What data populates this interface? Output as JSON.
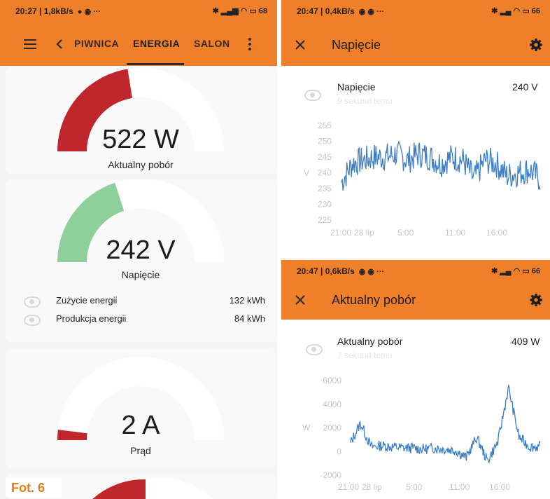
{
  "left": {
    "status": {
      "time": "20:27 | 1,8kB/s",
      "battery": "68"
    },
    "tabs": [
      "PIWNICA",
      "ENERGIA",
      "SALON"
    ],
    "gauges": [
      {
        "value": "522 W",
        "label": "Aktualny pobór",
        "level": 0.45,
        "color": "#c0272d"
      },
      {
        "value": "242 V",
        "label": "Napięcie",
        "level": 0.4,
        "color": "#8fcf9c"
      },
      {
        "value": "2 A",
        "label": "Prąd",
        "level": 0.04,
        "color": "#c0272d"
      }
    ],
    "list": [
      {
        "label": "Zużycie energii",
        "value": "132 kWh"
      },
      {
        "label": "Produkcja energii",
        "value": "84 kWh"
      }
    ]
  },
  "right_top": {
    "status": {
      "time": "20:47 | 0,4kB/s",
      "battery": "66"
    },
    "title": "Napięcie",
    "chart_title": "Napięcie",
    "chart_sub": "9 sekund temu",
    "chart_value": "240 V",
    "ylabel": "V"
  },
  "right_bottom": {
    "status": {
      "time": "20:47 | 0,6kB/s",
      "battery": "66"
    },
    "title": "Aktualny pobór",
    "chart_title": "Aktualny pobór",
    "chart_sub": "7 sekund temu",
    "chart_value": "409 W",
    "ylabel": "W"
  },
  "caption": "Fot. 6",
  "chart_data": [
    {
      "type": "line",
      "title": "Napięcie",
      "ylabel": "V",
      "ylim": [
        225,
        255
      ],
      "yticks": [
        "255",
        "250",
        "245",
        "240",
        "235",
        "230",
        "225"
      ],
      "xticks": [
        "21:00",
        "28 lip",
        "5:00",
        "11:00",
        "16:00"
      ],
      "series": [
        {
          "values": [
            237,
            243,
            244,
            245,
            245,
            246,
            244,
            246,
            245,
            243,
            245,
            244,
            238,
            244,
            243,
            239,
            240,
            241,
            238
          ]
        }
      ]
    },
    {
      "type": "line",
      "title": "Aktualny pobór",
      "ylabel": "W",
      "ylim": [
        -2000,
        6000
      ],
      "yticks": [
        "6000",
        "4000",
        "2000",
        "0",
        "-2000"
      ],
      "xticks": [
        "21:00",
        "28 lip",
        "5:00",
        "11:00",
        "16:00"
      ],
      "series": [
        {
          "values": [
            600,
            2400,
            400,
            500,
            400,
            300,
            300,
            200,
            300,
            200,
            100,
            -500,
            1200,
            -800,
            800,
            5400,
            1200,
            400,
            400
          ]
        }
      ]
    }
  ]
}
